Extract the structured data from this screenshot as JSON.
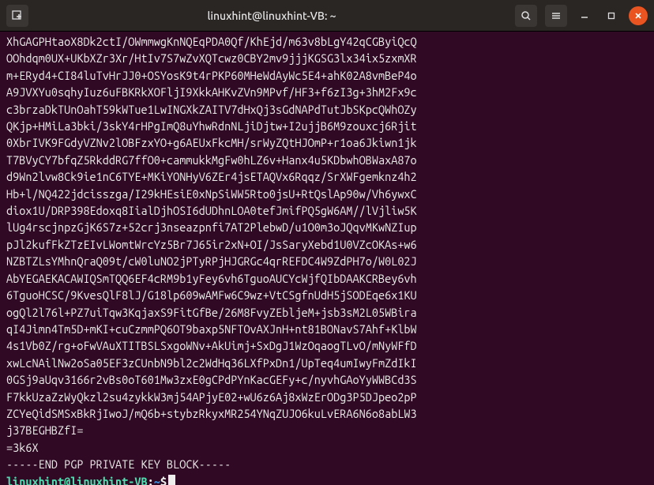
{
  "window": {
    "title": "linuxhint@linuxhint-VB: ~"
  },
  "terminal": {
    "lines": [
      "XhGAGPHtaoX8Dk2ctI/OWmmwgKnNQEqPDA0Qf/KhEjd/m63v8bLgY42qCGByiQcQ",
      "OOhdqm0UX+UKbXZr3Xr/HtIv7S7wZvXQTcwz0CBY2mv9jjjKGSG3lx34ix5zxmXR",
      "m+ERyd4+CI84luTvHrJJ0+OSYosK9t4rPKP60MHeWdAyWc5E4+ahK02A8vmBeP4o",
      "A9JVXYu0sqhyIuz6uFBKRkXOFljI9XkkAHKvZVn9MPvf/HF3+f6zI3g+3hM2Fx9c",
      "c3brzaDkTUnOahT59kWTue1LwINGXkZAITV7dHxQj3sGdNAPdTutJbSKpcQWhOZy",
      "QKjp+HMiLa3bki/3skY4rHPgImQ8uYhwRdnNLjiDjtw+I2ujjB6M9zouxcj6Rjit",
      "0XbrIVK9FGdyVZNv2lOBFzxYO+g6AEUxFkcMH/srWyZQtHJOmP+r1oa6Jkiwn1jk",
      "T7BVyCY7bfqZ5RkddRG7ffO0+cammukkMgFw0hLZ6v+Hanx4u5KDbwhOBWaxA87o",
      "d9Wn2lvw8Ck9ie1nC6TYE+MKiYONHyV6ZEr4jsETAQVx6Rqqz/SrXWFgemknz4h2",
      "Hb+l/NQ422jdcisszga/I29kHEsiE0xNpSiWW5Rto0jsU+RtQslAp90w/Vh6ywxC",
      "diox1U/DRP398Edoxq8IialDjhOSI6dUDhnLOA0tefJmifPQ5gW6AM//lVjliw5K",
      "lUg4rscjnpzGjK6S7z+52crj3nseazpnfi7AT2PlebwD/u1O0m3oJQqvMKwNZIup",
      "pJl2kufFkZTzEIvLWomtWrcYz5Br7J65ir2xN+OI/JsSaryXebd1U0VZcOKAs+w6",
      "NZBTZLsYMhnQraQ09t/cW0luNO2jPTyRPjHJGRGc4qrREFDC4W9ZdPH7o/W0L02J",
      "AbYEGAEKACAWIQSmTQQ6EF4cRM9b1yFey6vh6TguoAUCYcWjfQIbDAAKCRBey6vh",
      "6TguoHCSC/9KvesQlF8lJ/G18lp609wAMFw6C9wz+VtCSgfnUdH5jSODEqe6x1KU",
      "ogQl2l76l+PZ7uiTqw3KqjaxS9FitGfBe/26M8FvyZEbljeM+jsb3sM2L05WBira",
      "qI4Jimn4Tm5D+mKI+cuCzmmPQ6OT9baxp5NFTOvAXJnH+nt81BONavS7Ahf+KlbW",
      "4s1Vb0Z/rg+oFwVAuXTITBSLSxgoWNv+AkUimj+SxDgJ1WzOqaogTLvO/mNyWFfD",
      "xwLcNAilNw2oSa05EF3zCUnbN9bl2c2WdHq36LXfPxDn1/UpTeq4umIwyFmZdIkI",
      "0GSj9aUqv3166r2vBs0oT601Mw3zxE0gCPdPYnKacGEFy+c/nyvhGAoYyWWBCd3S",
      "F7kkUzaZzWyQkzl2su4zykkW3mj54APjyE02+wU6z6Aj8xWzErODg3P5DJpeo2pP",
      "ZCYeQidSMSxBkRjIwoJ/mQ6b+stybzRkyxMR254YNqZUJO6kuLvERA6N6o8abLW3",
      "j37BEGHBZfI=",
      "=3k6X",
      "-----END PGP PRIVATE KEY BLOCK-----"
    ],
    "prompt_user": "linuxhint@linuxhint-VB",
    "prompt_colon": ":",
    "prompt_path": "~",
    "prompt_end": "$"
  }
}
